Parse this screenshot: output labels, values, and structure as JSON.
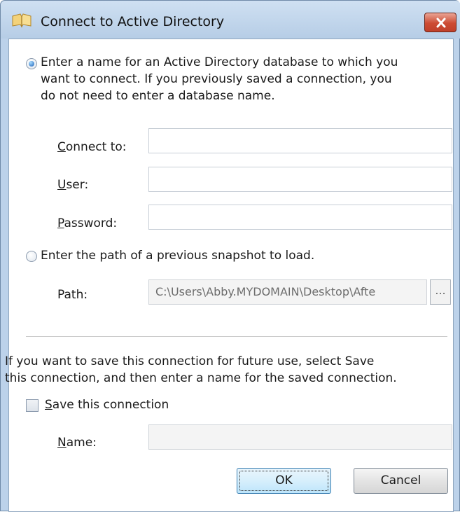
{
  "window": {
    "title": "Connect to Active Directory",
    "close_label": "×"
  },
  "option_connect": {
    "selected": true,
    "line1": "Enter a name for an Active Directory database to which you",
    "line2": "want to connect. If you previously saved a connection, you",
    "line3": "do not need to enter a database name."
  },
  "connect_to": {
    "label_ul": "C",
    "label_rest": "onnect to:",
    "value": ""
  },
  "user": {
    "label_ul": "U",
    "label_rest": "ser:",
    "value": ""
  },
  "password": {
    "label_ul": "P",
    "label_rest": "assword:",
    "value": ""
  },
  "option_snapshot": {
    "selected": false,
    "label": "Enter the path of a previous snapshot to load."
  },
  "path": {
    "label": "Path:",
    "value": "C:\\Users\\Abby.MYDOMAIN\\Desktop\\Afte",
    "browse_label": "..."
  },
  "save_info": {
    "line1": "If you want to save this connection for future use, select Save",
    "line2": "this connection, and then enter a name for the saved connection."
  },
  "save_connection": {
    "checked": false,
    "label_ul": "S",
    "label_rest": "ave this connection"
  },
  "name": {
    "label_ul": "N",
    "label_rest": "ame:",
    "value": ""
  },
  "buttons": {
    "ok": "OK",
    "cancel": "Cancel"
  },
  "colors": {
    "title_bar": "#bcd2ea",
    "close_button": "#c94a34",
    "default_button": "#d7effc"
  }
}
